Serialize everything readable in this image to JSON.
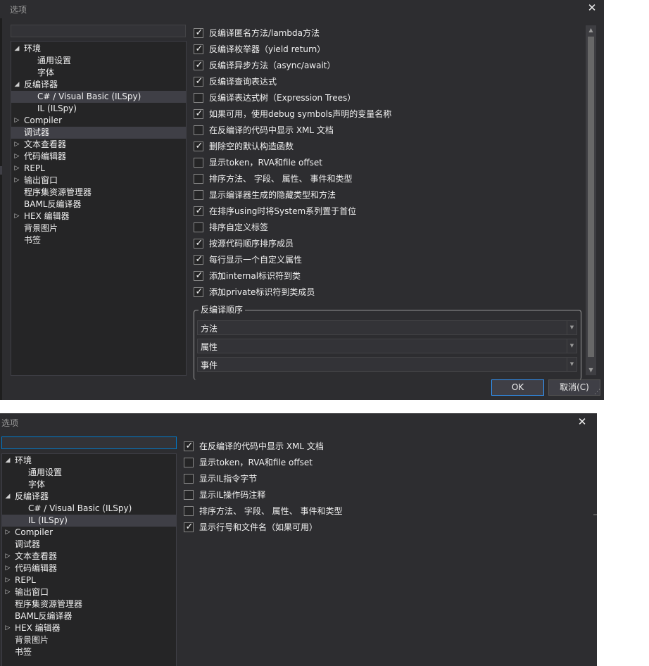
{
  "dialog1": {
    "title": "选项",
    "tree": [
      {
        "label": "环境",
        "level": 0,
        "toggle": "expanded"
      },
      {
        "label": "通用设置",
        "level": 1,
        "toggle": "none"
      },
      {
        "label": "字体",
        "level": 1,
        "toggle": "none"
      },
      {
        "label": "反编译器",
        "level": 0,
        "toggle": "expanded"
      },
      {
        "label": "C# / Visual Basic (ILSpy)",
        "level": 1,
        "toggle": "none",
        "selected": true
      },
      {
        "label": "IL (ILSpy)",
        "level": 1,
        "toggle": "none"
      },
      {
        "label": "Compiler",
        "level": 0,
        "toggle": "collapsed"
      },
      {
        "label": "调试器",
        "level": 0,
        "toggle": "none",
        "selected": true
      },
      {
        "label": "文本查看器",
        "level": 0,
        "toggle": "collapsed"
      },
      {
        "label": "代码编辑器",
        "level": 0,
        "toggle": "collapsed"
      },
      {
        "label": "REPL",
        "level": 0,
        "toggle": "collapsed"
      },
      {
        "label": "输出窗口",
        "level": 0,
        "toggle": "collapsed"
      },
      {
        "label": "程序集资源管理器",
        "level": 0,
        "toggle": "none"
      },
      {
        "label": "BAML反编译器",
        "level": 0,
        "toggle": "none"
      },
      {
        "label": "HEX 编辑器",
        "level": 0,
        "toggle": "collapsed"
      },
      {
        "label": "背景图片",
        "level": 0,
        "toggle": "none"
      },
      {
        "label": "书签",
        "level": 0,
        "toggle": "none"
      }
    ],
    "options": [
      {
        "label": "反编译匿名方法/lambda方法",
        "checked": true
      },
      {
        "label": "反编译枚举器（yield return）",
        "checked": true
      },
      {
        "label": "反编译异步方法（async/await）",
        "checked": true
      },
      {
        "label": "反编译查询表达式",
        "checked": true
      },
      {
        "label": "反编译表达式树（Expression Trees）",
        "checked": false
      },
      {
        "label": "如果可用，使用debug symbols声明的变量名称",
        "checked": true
      },
      {
        "label": "在反编译的代码中显示 XML 文档",
        "checked": false
      },
      {
        "label": "删除空的默认构造函数",
        "checked": true
      },
      {
        "label": "显示token，RVA和file offset",
        "checked": false
      },
      {
        "label": "排序方法、 字段、 属性、 事件和类型",
        "checked": false
      },
      {
        "label": "显示编译器生成的隐藏类型和方法",
        "checked": false
      },
      {
        "label": "在排序using时将System系列置于首位",
        "checked": true
      },
      {
        "label": "排序自定义标签",
        "checked": false
      },
      {
        "label": "按源代码顺序排序成员",
        "checked": true
      },
      {
        "label": "每行显示一个自定义属性",
        "checked": true
      },
      {
        "label": "添加internal标识符到类",
        "checked": true
      },
      {
        "label": "添加private标识符到类成员",
        "checked": true
      }
    ],
    "group": {
      "title": "反编译顺序",
      "combos": [
        "方法",
        "属性",
        "事件"
      ]
    },
    "ok_label": "OK",
    "cancel_label": "取消(C)"
  },
  "dialog2": {
    "title": "选项",
    "tree": [
      {
        "label": "环境",
        "level": 0,
        "toggle": "expanded"
      },
      {
        "label": "通用设置",
        "level": 1,
        "toggle": "none"
      },
      {
        "label": "字体",
        "level": 1,
        "toggle": "none"
      },
      {
        "label": "反编译器",
        "level": 0,
        "toggle": "expanded"
      },
      {
        "label": "C# / Visual Basic (ILSpy)",
        "level": 1,
        "toggle": "none"
      },
      {
        "label": "IL (ILSpy)",
        "level": 1,
        "toggle": "none",
        "selected": true
      },
      {
        "label": "Compiler",
        "level": 0,
        "toggle": "collapsed"
      },
      {
        "label": "调试器",
        "level": 0,
        "toggle": "none"
      },
      {
        "label": "文本查看器",
        "level": 0,
        "toggle": "collapsed"
      },
      {
        "label": "代码编辑器",
        "level": 0,
        "toggle": "collapsed"
      },
      {
        "label": "REPL",
        "level": 0,
        "toggle": "collapsed"
      },
      {
        "label": "输出窗口",
        "level": 0,
        "toggle": "collapsed"
      },
      {
        "label": "程序集资源管理器",
        "level": 0,
        "toggle": "none"
      },
      {
        "label": "BAML反编译器",
        "level": 0,
        "toggle": "none"
      },
      {
        "label": "HEX 编辑器",
        "level": 0,
        "toggle": "collapsed"
      },
      {
        "label": "背景图片",
        "level": 0,
        "toggle": "none"
      },
      {
        "label": "书签",
        "level": 0,
        "toggle": "none"
      }
    ],
    "options": [
      {
        "label": "在反编译的代码中显示 XML 文档",
        "checked": true
      },
      {
        "label": "显示token，RVA和file offset",
        "checked": false
      },
      {
        "label": "显示IL指令字节",
        "checked": false
      },
      {
        "label": "显示IL操作码注释",
        "checked": false
      },
      {
        "label": "排序方法、 字段、 属性、 事件和类型",
        "checked": false
      },
      {
        "label": "显示行号和文件名（如果可用）",
        "checked": true
      }
    ]
  },
  "icons": {
    "close": "close-icon",
    "expanded": "triangle-expanded-icon",
    "collapsed": "triangle-collapsed-icon",
    "check": "checkmark-icon",
    "dropdown": "chevron-down-icon"
  },
  "colors": {
    "window_bg": "#2d2d30",
    "tree_bg": "#252526",
    "selection": "#3f3f46",
    "accent": "#007acc",
    "text": "#f1f1f1"
  }
}
